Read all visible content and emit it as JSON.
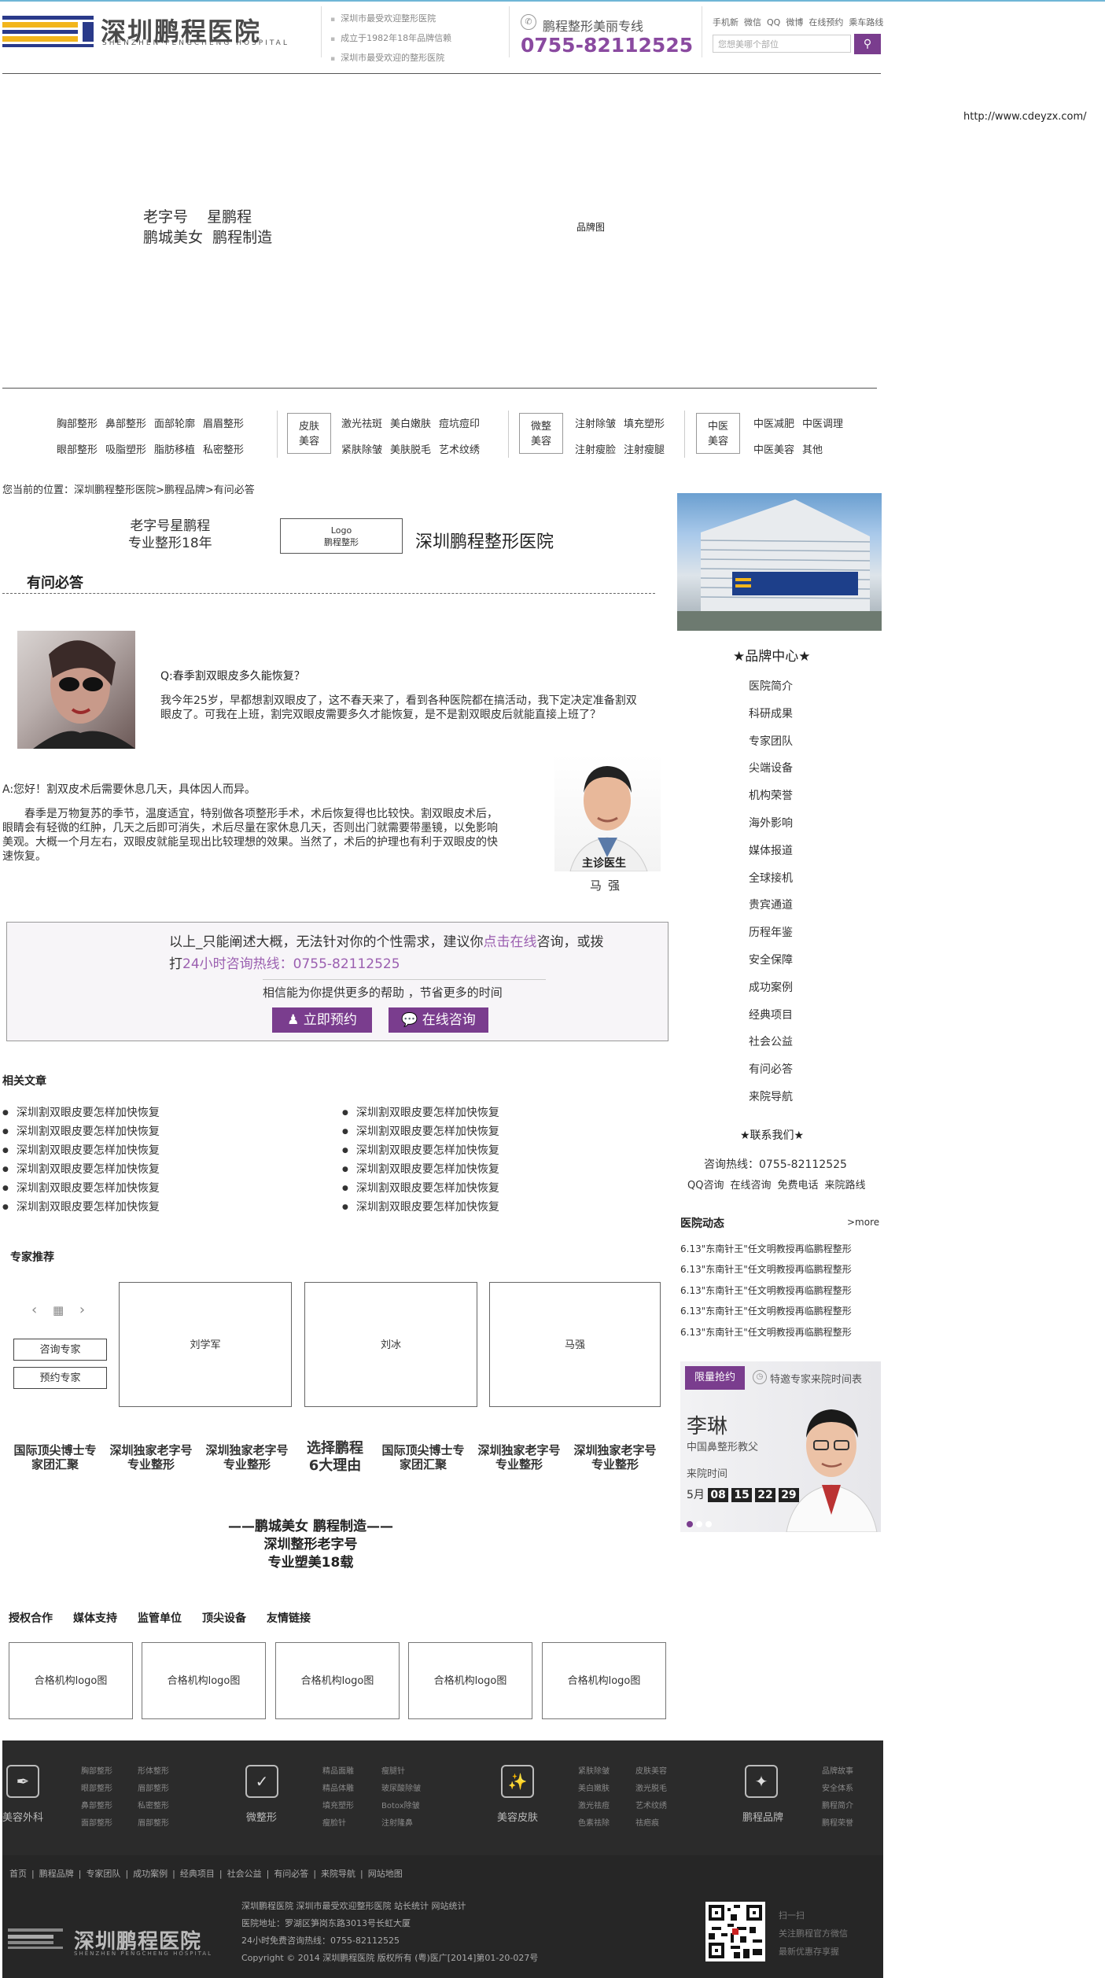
{
  "header": {
    "logo_text": "深圳鹏程医院",
    "logo_sub": "SHENZHEN PENGCHENG HOSPITAL",
    "news": [
      "深圳市最受欢迎整形医院",
      "成立于1982年18年品牌信赖",
      "深圳市最受欢迎的整形医院"
    ],
    "hotline_label": "鹏程整形美丽专线",
    "hotline_number": "0755-82112525",
    "top_links": [
      "手机新",
      "微信",
      "QQ",
      "微博",
      "在线预约",
      "乘车路线"
    ],
    "search_placeholder": "您想美哪个部位",
    "search_icon": "search-icon"
  },
  "url_text": "http://www.cdeyzx.com/",
  "banner": {
    "slogan": "老字号    星鹏程\n鹏城美女  鹏程制造",
    "image_label": "品牌图"
  },
  "menu": {
    "row1_a": [
      "胸部整形",
      "鼻部整形",
      "面部轮廓",
      "眉眉整形"
    ],
    "row2_a": [
      "眼部整形",
      "吸脂塑形",
      "脂肪移植",
      "私密整形"
    ],
    "box1": "皮肤\n美容",
    "row1_b": [
      "激光祛斑",
      "美白嫩肤",
      "痘坑痘印"
    ],
    "row2_b": [
      "紧肤除皱",
      "美肤脱毛",
      "艺术纹绣"
    ],
    "box2": "微整\n美容",
    "row1_c": [
      "注射除皱",
      "填充塑形"
    ],
    "row2_c": [
      "注射瘦脸",
      "注射瘦腿"
    ],
    "box3": "中医\n美容",
    "row1_d": [
      "中医减肥",
      "中医调理"
    ],
    "row2_d": [
      "中医美容",
      "其他"
    ]
  },
  "breadcrumb": "您当前的位置：深圳鹏程整形医院>鹏程品牌>有问必答",
  "article_head": {
    "left_l1": "老字号星鹏程",
    "left_l2": "专业整形18年",
    "logo_l1": "Logo",
    "logo_l2": "鹏程整形",
    "hospital": "深圳鹏程整形医院"
  },
  "section_title": "有问必答",
  "qa": {
    "question": "Q:春季割双眼皮多久能恢复？",
    "question_body": "我今年25岁，早都想割双眼皮了，这不春天来了，看到各种医院都在搞活动，我下定决定准备割双眼皮了。可我在上班，割完双眼皮需要多久才能恢复，是不是割双眼皮后就能直接上班了？",
    "answer": "A:您好！割双皮术后需要休息几天，具体因人而异。",
    "answer_body": "春季是万物复苏的季节，温度适宜，特别做各项整形手术，术后恢复得也比较快。割双眼皮术后，眼睛会有轻微的红肿，几天之后即可消失，术后尽量在家休息几天，否则出门就需要带墨镜，以免影响美观。大概一个月左右，双眼皮就能呈现出比较理想的效果。当然了，术后的护理也有利于双眼皮的快速恢复。",
    "doctor_caption": "主诊医生",
    "doctor_name": "马强"
  },
  "consult": {
    "l1_a": "以上_只能阐述大概，无法针对你的个性需求，建议你",
    "l1_link": "点击在线",
    "l1_b": "咨询，或拨",
    "l2_a": "打",
    "l2_link": "24小时咨询热线：0755-82112525",
    "l3": "相信能为你提供更多的帮助 ，节省更多的时间",
    "btn_book": "立即预约",
    "btn_chat": "在线咨询"
  },
  "related": {
    "title": "相关文章",
    "left": [
      "深圳割双眼皮要怎样加快恢复",
      "深圳割双眼皮要怎样加快恢复",
      "深圳割双眼皮要怎样加快恢复",
      "深圳割双眼皮要怎样加快恢复",
      "深圳割双眼皮要怎样加快恢复",
      "深圳割双眼皮要怎样加快恢复"
    ],
    "right": [
      "深圳割双眼皮要怎样加快恢复",
      "深圳割双眼皮要怎样加快恢复",
      "深圳割双眼皮要怎样加快恢复",
      "深圳割双眼皮要怎样加快恢复",
      "深圳割双眼皮要怎样加快恢复",
      "深圳割双眼皮要怎样加快恢复"
    ]
  },
  "experts": {
    "title": "专家推荐",
    "btn_consult": "咨询专家",
    "btn_book": "预约专家",
    "cards": [
      "刘学军",
      "刘冰",
      "马强"
    ]
  },
  "reasons": [
    "国际顶尖博士专\n家团汇聚",
    "深圳独家老字号\n专业整形",
    "深圳独家老字号\n专业整形",
    "选择鹏程\n6大理由",
    "国际顶尖博士专\n家团汇聚",
    "深圳独家老字号\n专业整形",
    "深圳独家老字号\n专业整形"
  ],
  "slogan": [
    "——鹏城美女    鹏程制造——",
    "深圳整形老字号",
    "专业塑美18载"
  ],
  "partner_tabs": [
    "授权合作",
    "媒体支持",
    "监管单位",
    "顶尖设备",
    "友情链接"
  ],
  "partner_logos": [
    "合格机构logo图",
    "合格机构logo图",
    "合格机构logo图",
    "合格机构logo图",
    "合格机构logo图"
  ],
  "sidebar": {
    "brand_title": "★品牌中心★",
    "brand_items": [
      "医院简介",
      "科研成果",
      "专家团队",
      "尖端设备",
      "机构荣誉",
      "海外影响",
      "媒体报道",
      "全球接机",
      "贵宾通道",
      "历程年鉴",
      "安全保障",
      "成功案例",
      "经典项目",
      "社会公益",
      "有问必答",
      "来院导航"
    ],
    "contact_title": "★联系我们★",
    "contact_tel": "咨询热线：0755-82112525",
    "contact_links": [
      "QQ咨询",
      "在线咨询",
      "免费电话",
      "来院路线"
    ],
    "dyn_title": "医院动态",
    "dyn_more": ">more",
    "dyn_items": [
      "6.13\"东南针王\"任文明教授再临鹏程整形",
      "6.13\"东南针王\"任文明教授再临鹏程整形",
      "6.13\"东南针王\"任文明教授再临鹏程整形",
      "6.13\"东南针王\"任文明教授再临鹏程整形",
      "6.13\"东南针王\"任文明教授再临鹏程整形"
    ],
    "promo_tag": "限量抢约",
    "promo_head": "特邀专家来院时间表",
    "promo_name": "李琳",
    "promo_title": "中国鼻整形教父",
    "promo_time_label": "来院时间",
    "promo_month": "5月",
    "promo_days": [
      "08",
      "15",
      "22",
      "29"
    ]
  },
  "footer": {
    "cats": [
      {
        "label": "美容外科",
        "icon": "scalpel-icon",
        "col1": [
          "胸部整形",
          "眼部整形",
          "鼻部整形",
          "面部整形"
        ],
        "col2": [
          "形体整形",
          "眉部整形",
          "私密整形",
          "眉部整形"
        ]
      },
      {
        "label": "微整形",
        "icon": "syringe-icon",
        "col1": [
          "精品面雕",
          "精品体雕",
          "填充塑形",
          "瘦脸针"
        ],
        "col2": [
          "瘦腿针",
          "玻尿酸除皱",
          "Botox除皱",
          "注射隆鼻"
        ]
      },
      {
        "label": "美容皮肤",
        "icon": "sparkle-wand-icon",
        "col1": [
          "紧肤除皱",
          "美白嫩肤",
          "激光祛痘",
          "色素祛除"
        ],
        "col2": [
          "皮肤美容",
          "激光脱毛",
          "艺术纹绣",
          "祛疤痕"
        ]
      },
      {
        "label": "鹏程品牌",
        "icon": "star-wand-icon",
        "col1": [
          "品牌故事",
          "安全体系",
          "鹏程简介",
          "鹏程荣誉"
        ],
        "col2": []
      }
    ],
    "nav": [
      "首页",
      "|",
      "鹏程品牌",
      "|",
      "专家团队",
      "|",
      "成功案例",
      "|",
      "经典项目",
      "|",
      "社会公益",
      "|",
      "有问必答",
      "|",
      "来院导航",
      "|",
      "网站地图"
    ],
    "info": [
      "深圳鹏程医院 深圳市最受欢迎整形医院   站长统计   网站统计",
      "医院地址：罗湖区笋岗东路3013号长虹大厦",
      "24小时免费咨询热线：0755-82112525",
      "Copyright © 2014 深圳鹏程医院 版权所有 (粤)医广[2014]第01-20-027号"
    ],
    "logo_text": "深圳鹏程医院",
    "logo_sub": "SHENZHEN PENGCHENG HOSPITAL",
    "qr_text": [
      "扫一扫",
      "关注鹏程官方微信",
      "最新优惠存享握"
    ]
  }
}
